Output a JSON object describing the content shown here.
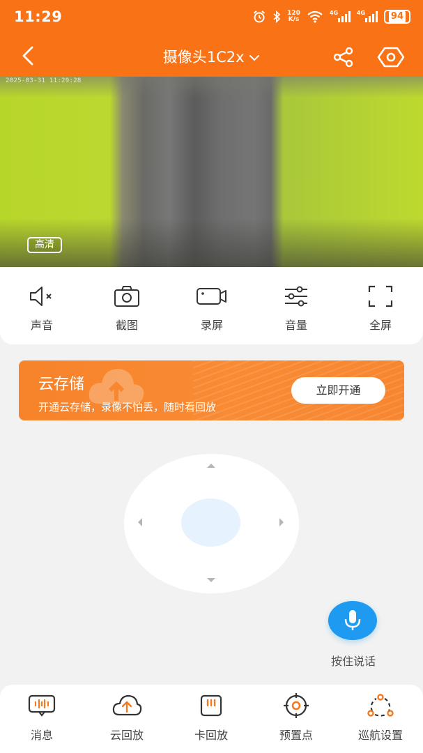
{
  "status_bar": {
    "time": "11:29",
    "net_speed_value": "120",
    "net_speed_unit": "K/s",
    "signal1_label": "4G",
    "signal2_label": "4G",
    "battery": "94"
  },
  "header": {
    "title": "摄像头1C2x",
    "icons": [
      "back-icon",
      "chevron-down-icon",
      "share-icon",
      "settings-icon"
    ]
  },
  "video": {
    "timestamp": "2025-03-31 11:29:28",
    "quality_label": "高清"
  },
  "controls": [
    {
      "label": "声音",
      "icon": "speaker-muted-icon"
    },
    {
      "label": "截图",
      "icon": "camera-icon"
    },
    {
      "label": "录屏",
      "icon": "video-record-icon"
    },
    {
      "label": "音量",
      "icon": "sliders-icon"
    },
    {
      "label": "全屏",
      "icon": "fullscreen-icon"
    }
  ],
  "cloud_banner": {
    "title": "云存储",
    "subtitle": "开通云存储，录像不怕丢，随时看回放",
    "button": "立即开通"
  },
  "ptz": {
    "directions": [
      "up",
      "down",
      "left",
      "right"
    ]
  },
  "talk": {
    "label": "按住说话",
    "icon": "microphone-icon"
  },
  "bottom_nav": [
    {
      "label": "消息",
      "icon": "message-icon"
    },
    {
      "label": "云回放",
      "icon": "cloud-upload-icon"
    },
    {
      "label": "卡回放",
      "icon": "sd-card-icon"
    },
    {
      "label": "预置点",
      "icon": "target-icon"
    },
    {
      "label": "巡航设置",
      "icon": "cruise-icon"
    }
  ],
  "colors": {
    "brand": "#f97316",
    "banner": "#f98b35",
    "talk_button": "#1e9bf0",
    "icon_orange": "#f47a1f"
  }
}
